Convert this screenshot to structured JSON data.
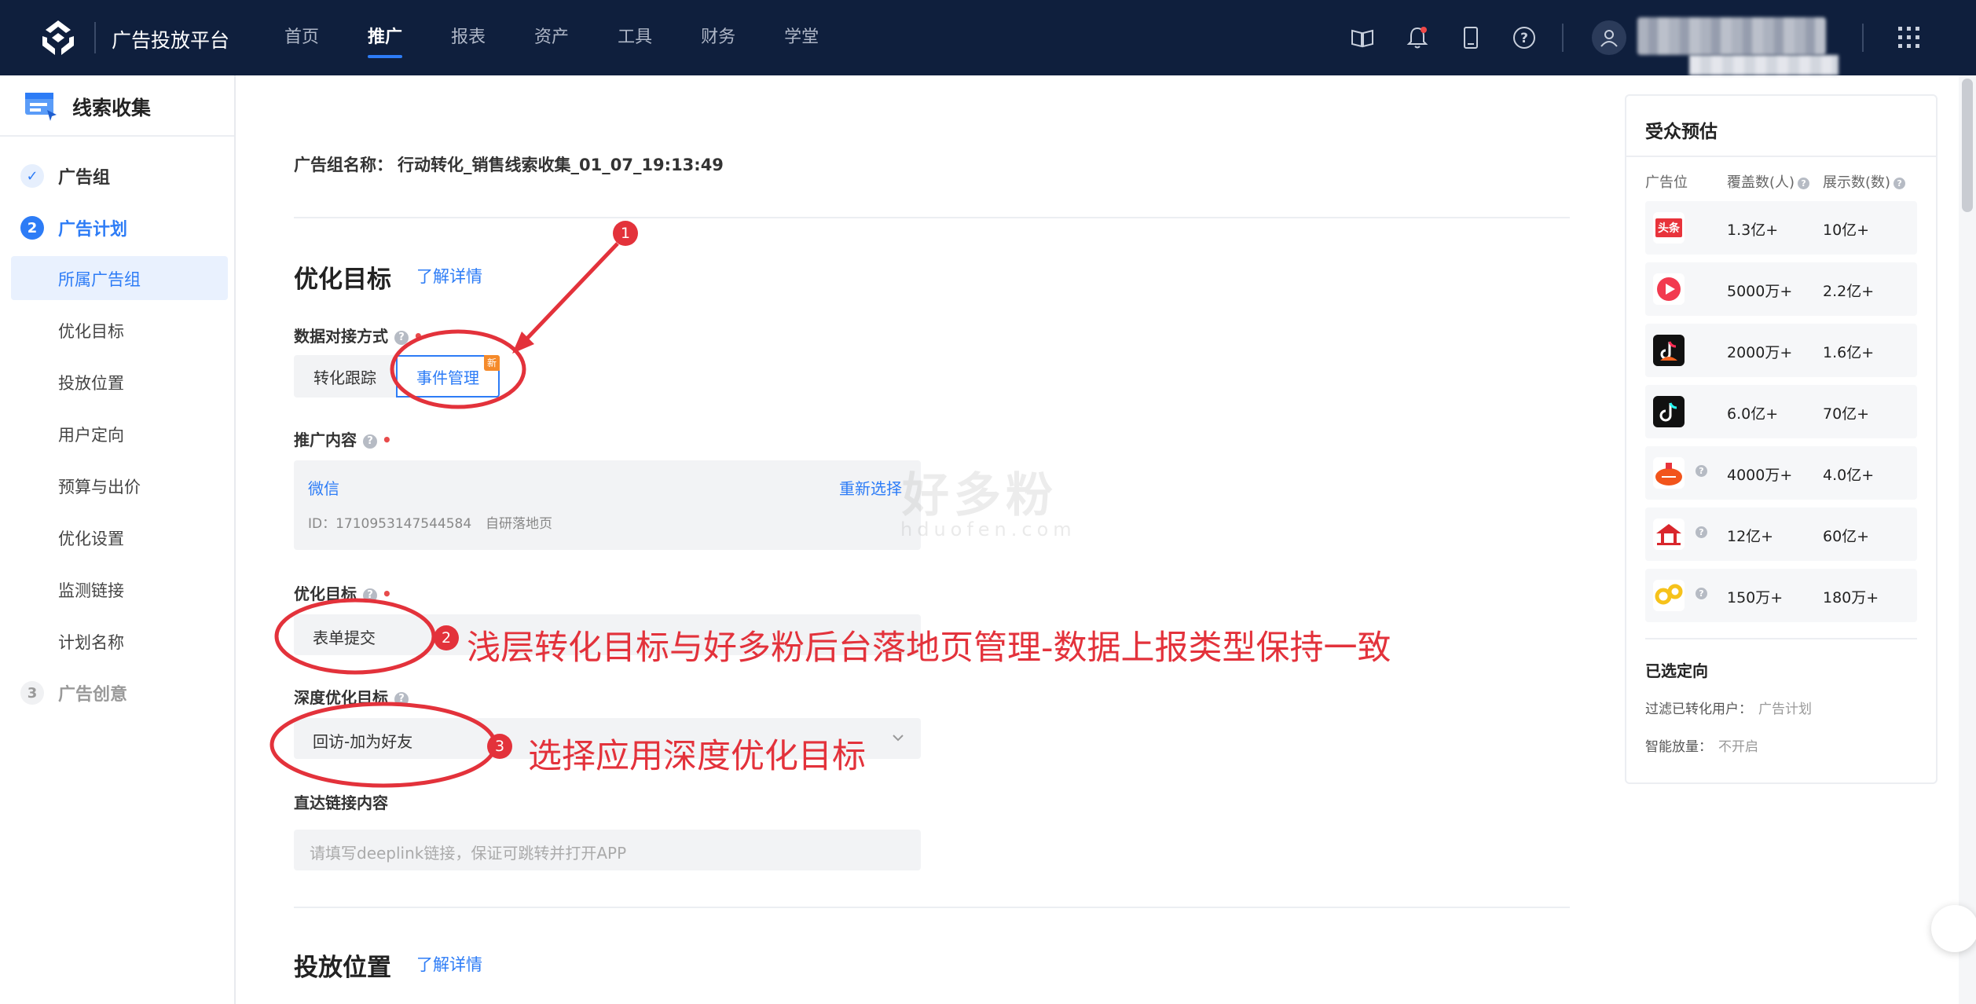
{
  "topbar": {
    "app_title": "广告投放平台",
    "nav": [
      "首页",
      "推广",
      "报表",
      "资产",
      "工具",
      "财务",
      "学堂"
    ],
    "active_nav": "推广"
  },
  "sidebar": {
    "title": "线索收集",
    "steps": [
      {
        "num": "✓",
        "label": "广告组"
      },
      {
        "num": "2",
        "label": "广告计划"
      },
      {
        "num": "3",
        "label": "广告创意"
      }
    ],
    "sub_items": [
      "所属广告组",
      "优化目标",
      "投放位置",
      "用户定向",
      "预算与出价",
      "优化设置",
      "监测链接",
      "计划名称"
    ]
  },
  "main": {
    "group_name_label": "广告组名称：",
    "group_name_value": "行动转化_销售线索收集_01_07_19:13:49",
    "opt_section_title": "优化目标",
    "learn_more": "了解详情",
    "data_method_label": "数据对接方式",
    "data_method_options": [
      "转化跟踪",
      "事件管理"
    ],
    "new_badge": "新",
    "promo_content_label": "推广内容",
    "promo_channel": "微信",
    "promo_reselect": "重新选择",
    "promo_id": "ID：1710953147544584",
    "promo_type": "自研落地页",
    "opt_goal_label": "优化目标",
    "opt_goal_value": "表单提交",
    "deep_goal_label": "深度优化目标",
    "deep_goal_value": "回访-加为好友",
    "deeplink_label": "直达链接内容",
    "deeplink_placeholder": "请填写deeplink链接，保证可跳转并打开APP",
    "placement_title": "投放位置",
    "placement_learn_more": "了解详情"
  },
  "annotations": {
    "n1": "1",
    "n2": "2",
    "n3": "3",
    "text2": "浅层转化目标与好多粉后台落地页管理-数据上报类型保持一致",
    "text3": "选择应用深度优化目标",
    "color": "#e3323b"
  },
  "watermark": {
    "cn": "好多粉",
    "en": "hduofen.com"
  },
  "audience": {
    "title": "受众预估",
    "headers": [
      "广告位",
      "覆盖数(人)",
      "展示数(数)"
    ],
    "rows": [
      {
        "icon": "toutiao-icon",
        "cover": "1.3亿+",
        "show": "10亿+"
      },
      {
        "icon": "xigua-icon",
        "cover": "5000万+",
        "show": "2.2亿+"
      },
      {
        "icon": "douyin-fire-icon",
        "cover": "2000万+",
        "show": "1.6亿+"
      },
      {
        "icon": "douyin-icon",
        "cover": "6.0亿+",
        "show": "70亿+"
      },
      {
        "icon": "fanqie-icon",
        "cover": "4000万+",
        "show": "4.0亿+"
      },
      {
        "icon": "chuanshanjia-icon",
        "cover": "12亿+",
        "show": "60亿+"
      },
      {
        "icon": "ohayoo-icon",
        "cover": "150万+",
        "show": "180万+"
      }
    ],
    "selected_title": "已选定向",
    "filter_label": "过滤已转化用户：",
    "filter_value": "广告计划",
    "smart_label": "智能放量：",
    "smart_value": "不开启"
  }
}
